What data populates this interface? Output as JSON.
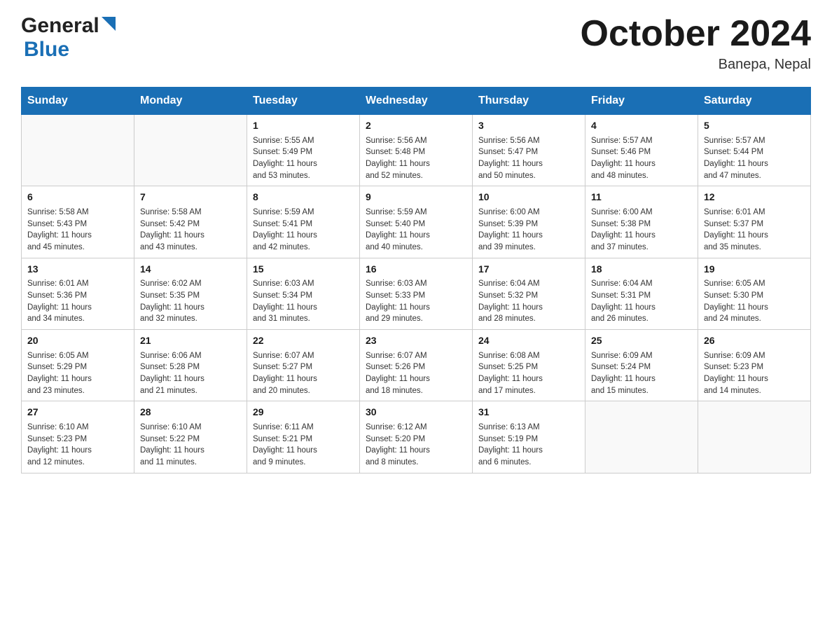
{
  "header": {
    "logo_general": "General",
    "logo_blue": "Blue",
    "month_title": "October 2024",
    "location": "Banepa, Nepal"
  },
  "weekdays": [
    "Sunday",
    "Monday",
    "Tuesday",
    "Wednesday",
    "Thursday",
    "Friday",
    "Saturday"
  ],
  "weeks": [
    [
      {
        "day": "",
        "info": ""
      },
      {
        "day": "",
        "info": ""
      },
      {
        "day": "1",
        "info": "Sunrise: 5:55 AM\nSunset: 5:49 PM\nDaylight: 11 hours\nand 53 minutes."
      },
      {
        "day": "2",
        "info": "Sunrise: 5:56 AM\nSunset: 5:48 PM\nDaylight: 11 hours\nand 52 minutes."
      },
      {
        "day": "3",
        "info": "Sunrise: 5:56 AM\nSunset: 5:47 PM\nDaylight: 11 hours\nand 50 minutes."
      },
      {
        "day": "4",
        "info": "Sunrise: 5:57 AM\nSunset: 5:46 PM\nDaylight: 11 hours\nand 48 minutes."
      },
      {
        "day": "5",
        "info": "Sunrise: 5:57 AM\nSunset: 5:44 PM\nDaylight: 11 hours\nand 47 minutes."
      }
    ],
    [
      {
        "day": "6",
        "info": "Sunrise: 5:58 AM\nSunset: 5:43 PM\nDaylight: 11 hours\nand 45 minutes."
      },
      {
        "day": "7",
        "info": "Sunrise: 5:58 AM\nSunset: 5:42 PM\nDaylight: 11 hours\nand 43 minutes."
      },
      {
        "day": "8",
        "info": "Sunrise: 5:59 AM\nSunset: 5:41 PM\nDaylight: 11 hours\nand 42 minutes."
      },
      {
        "day": "9",
        "info": "Sunrise: 5:59 AM\nSunset: 5:40 PM\nDaylight: 11 hours\nand 40 minutes."
      },
      {
        "day": "10",
        "info": "Sunrise: 6:00 AM\nSunset: 5:39 PM\nDaylight: 11 hours\nand 39 minutes."
      },
      {
        "day": "11",
        "info": "Sunrise: 6:00 AM\nSunset: 5:38 PM\nDaylight: 11 hours\nand 37 minutes."
      },
      {
        "day": "12",
        "info": "Sunrise: 6:01 AM\nSunset: 5:37 PM\nDaylight: 11 hours\nand 35 minutes."
      }
    ],
    [
      {
        "day": "13",
        "info": "Sunrise: 6:01 AM\nSunset: 5:36 PM\nDaylight: 11 hours\nand 34 minutes."
      },
      {
        "day": "14",
        "info": "Sunrise: 6:02 AM\nSunset: 5:35 PM\nDaylight: 11 hours\nand 32 minutes."
      },
      {
        "day": "15",
        "info": "Sunrise: 6:03 AM\nSunset: 5:34 PM\nDaylight: 11 hours\nand 31 minutes."
      },
      {
        "day": "16",
        "info": "Sunrise: 6:03 AM\nSunset: 5:33 PM\nDaylight: 11 hours\nand 29 minutes."
      },
      {
        "day": "17",
        "info": "Sunrise: 6:04 AM\nSunset: 5:32 PM\nDaylight: 11 hours\nand 28 minutes."
      },
      {
        "day": "18",
        "info": "Sunrise: 6:04 AM\nSunset: 5:31 PM\nDaylight: 11 hours\nand 26 minutes."
      },
      {
        "day": "19",
        "info": "Sunrise: 6:05 AM\nSunset: 5:30 PM\nDaylight: 11 hours\nand 24 minutes."
      }
    ],
    [
      {
        "day": "20",
        "info": "Sunrise: 6:05 AM\nSunset: 5:29 PM\nDaylight: 11 hours\nand 23 minutes."
      },
      {
        "day": "21",
        "info": "Sunrise: 6:06 AM\nSunset: 5:28 PM\nDaylight: 11 hours\nand 21 minutes."
      },
      {
        "day": "22",
        "info": "Sunrise: 6:07 AM\nSunset: 5:27 PM\nDaylight: 11 hours\nand 20 minutes."
      },
      {
        "day": "23",
        "info": "Sunrise: 6:07 AM\nSunset: 5:26 PM\nDaylight: 11 hours\nand 18 minutes."
      },
      {
        "day": "24",
        "info": "Sunrise: 6:08 AM\nSunset: 5:25 PM\nDaylight: 11 hours\nand 17 minutes."
      },
      {
        "day": "25",
        "info": "Sunrise: 6:09 AM\nSunset: 5:24 PM\nDaylight: 11 hours\nand 15 minutes."
      },
      {
        "day": "26",
        "info": "Sunrise: 6:09 AM\nSunset: 5:23 PM\nDaylight: 11 hours\nand 14 minutes."
      }
    ],
    [
      {
        "day": "27",
        "info": "Sunrise: 6:10 AM\nSunset: 5:23 PM\nDaylight: 11 hours\nand 12 minutes."
      },
      {
        "day": "28",
        "info": "Sunrise: 6:10 AM\nSunset: 5:22 PM\nDaylight: 11 hours\nand 11 minutes."
      },
      {
        "day": "29",
        "info": "Sunrise: 6:11 AM\nSunset: 5:21 PM\nDaylight: 11 hours\nand 9 minutes."
      },
      {
        "day": "30",
        "info": "Sunrise: 6:12 AM\nSunset: 5:20 PM\nDaylight: 11 hours\nand 8 minutes."
      },
      {
        "day": "31",
        "info": "Sunrise: 6:13 AM\nSunset: 5:19 PM\nDaylight: 11 hours\nand 6 minutes."
      },
      {
        "day": "",
        "info": ""
      },
      {
        "day": "",
        "info": ""
      }
    ]
  ]
}
